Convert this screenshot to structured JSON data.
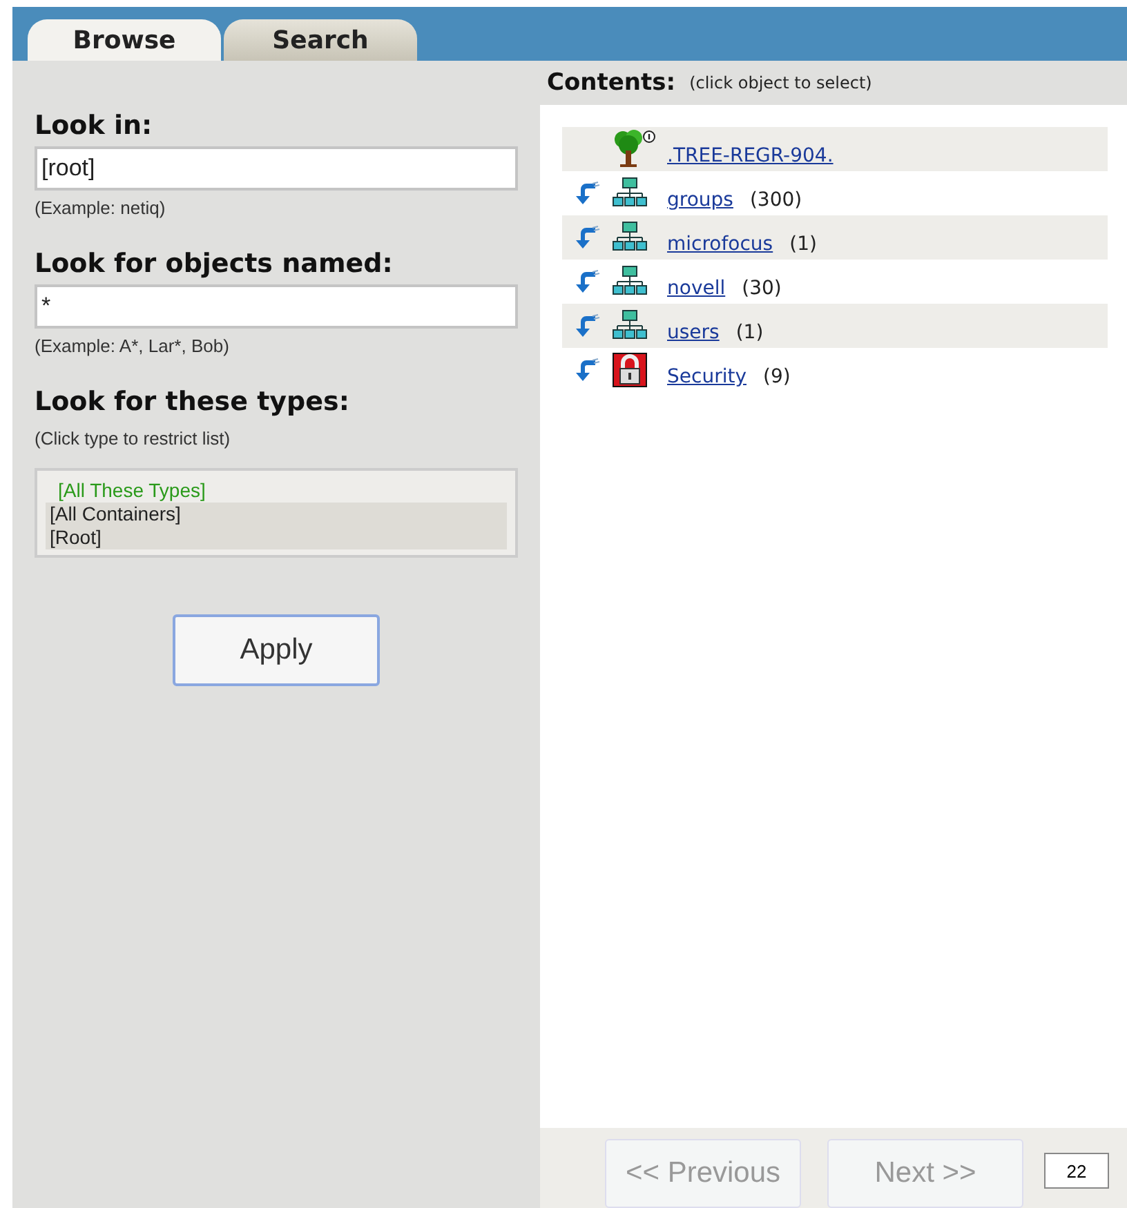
{
  "tabs": [
    {
      "label": "Browse",
      "selected": true
    },
    {
      "label": "Search",
      "selected": false
    }
  ],
  "look_in": {
    "label": "Look in:",
    "value": "[root]",
    "hint": "(Example: netiq)"
  },
  "look_for_named": {
    "label": "Look for objects named:",
    "value": "*",
    "hint": "(Example: A*, Lar*, Bob)"
  },
  "types": {
    "label": "Look for these types:",
    "hint": "(Click type to restrict list)",
    "items": [
      {
        "label": "[All These Types]",
        "selected": true
      },
      {
        "label": "[All Containers]",
        "selected": false
      },
      {
        "label": "[Root]",
        "selected": false
      }
    ]
  },
  "apply_button": "Apply",
  "contents": {
    "title": "Contents:",
    "hint": "(click object to select)",
    "rows": [
      {
        "kind": "tree",
        "name": ".TREE-REGR-904."
      },
      {
        "kind": "container",
        "name": "groups",
        "count": "(300)"
      },
      {
        "kind": "container",
        "name": "microfocus",
        "count": "(1)"
      },
      {
        "kind": "container",
        "name": "novell",
        "count": "(30)"
      },
      {
        "kind": "container",
        "name": "users",
        "count": "(1)"
      },
      {
        "kind": "locked",
        "name": "Security",
        "count": "(9)"
      }
    ]
  },
  "pager": {
    "previous": {
      "label": "<< Previous",
      "disabled": true
    },
    "next": {
      "label": "Next >>",
      "disabled": true
    },
    "page_size": "22"
  }
}
